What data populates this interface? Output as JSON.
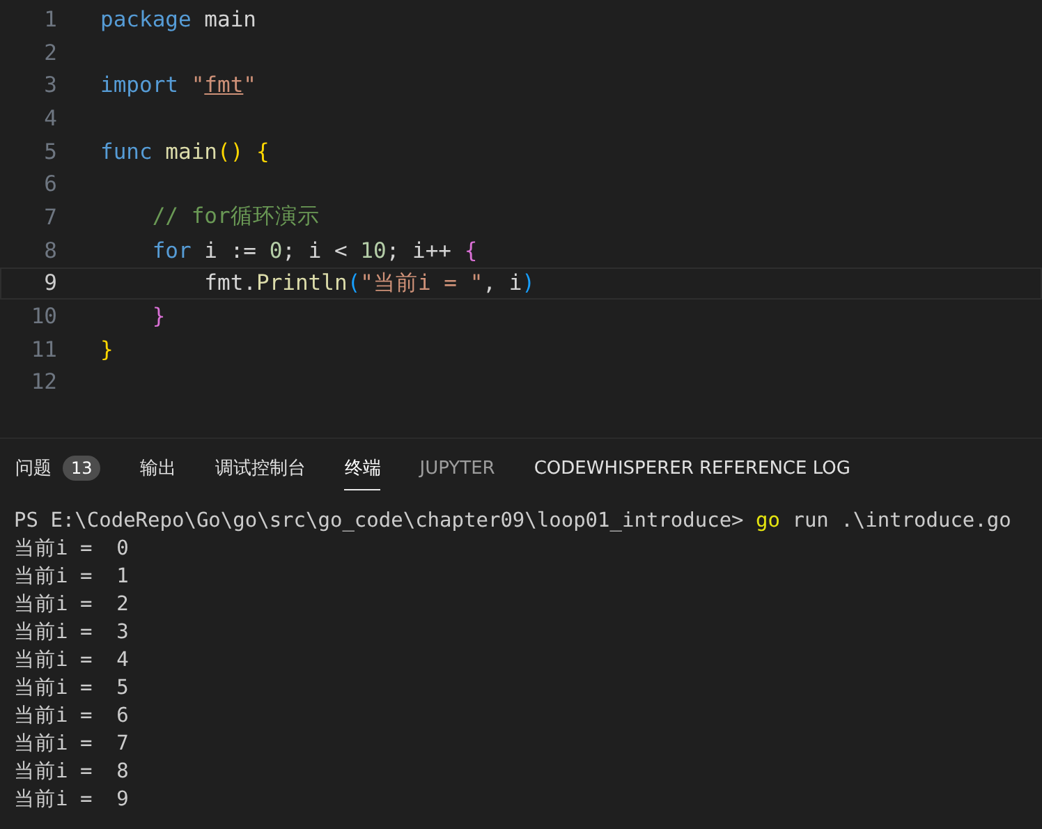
{
  "editor": {
    "lines": [
      {
        "number": "1",
        "current": false,
        "tokens": [
          {
            "kind": "keyword",
            "text": "package"
          },
          {
            "kind": "plain",
            "text": " main"
          }
        ]
      },
      {
        "number": "2",
        "current": false
      },
      {
        "number": "3",
        "current": false,
        "tokens": [
          {
            "kind": "keyword",
            "text": "import"
          },
          {
            "kind": "string",
            "text": " \""
          },
          {
            "kind": "link",
            "text": "fmt"
          },
          {
            "kind": "string",
            "text": "\""
          }
        ]
      },
      {
        "number": "4",
        "current": false
      },
      {
        "number": "5",
        "current": false,
        "tokens": [
          {
            "kind": "keyword",
            "text": "func"
          },
          {
            "kind": "function",
            "text": " main"
          },
          {
            "kind": "bracket1",
            "text": "()"
          },
          {
            "kind": "bracket1",
            "text": " {"
          }
        ]
      },
      {
        "number": "6",
        "current": false
      },
      {
        "number": "7",
        "current": false,
        "tokens": [
          {
            "kind": "comment",
            "text": "    // for循环演示"
          }
        ]
      },
      {
        "number": "8",
        "current": false,
        "tokens": [
          {
            "kind": "keyword",
            "text": "    for"
          },
          {
            "kind": "plain",
            "text": " i := "
          },
          {
            "kind": "number",
            "text": "0"
          },
          {
            "kind": "plain",
            "text": "; i < "
          },
          {
            "kind": "number",
            "text": "10"
          },
          {
            "kind": "plain",
            "text": "; i++ "
          },
          {
            "kind": "bracket2",
            "text": "{"
          }
        ]
      },
      {
        "number": "9",
        "current": true,
        "tokens": [
          {
            "kind": "plain",
            "text": "        fmt."
          },
          {
            "kind": "function",
            "text": "Println"
          },
          {
            "kind": "bracket3",
            "text": "("
          },
          {
            "kind": "string",
            "text": "\"当前i = \""
          },
          {
            "kind": "plain",
            "text": ", i"
          },
          {
            "kind": "bracket3",
            "text": ")"
          }
        ]
      },
      {
        "number": "10",
        "current": false,
        "tokens": [
          {
            "kind": "bracket2",
            "text": "    }"
          }
        ]
      },
      {
        "number": "11",
        "current": false,
        "tokens": [
          {
            "kind": "bracket1",
            "text": "}"
          }
        ]
      },
      {
        "number": "12",
        "current": false
      }
    ]
  },
  "panel": {
    "tabs": [
      {
        "label": "问题",
        "badge": "13",
        "selected": false,
        "dimmed": false
      },
      {
        "label": "输出",
        "selected": false,
        "dimmed": false
      },
      {
        "label": "调试控制台",
        "selected": false,
        "dimmed": false
      },
      {
        "label": "终端",
        "selected": true,
        "dimmed": false
      },
      {
        "label": "JUPYTER",
        "selected": false,
        "dimmed": true
      },
      {
        "label": "CODEWHISPERER REFERENCE LOG",
        "selected": false,
        "dimmed": false
      }
    ],
    "terminal": {
      "prompt": "PS E:\\CodeRepo\\Go\\go\\src\\go_code\\chapter09\\loop01_introduce> ",
      "command_name": "go",
      "command_args": " run .\\introduce.go",
      "output": [
        "当前i =  0",
        "当前i =  1",
        "当前i =  2",
        "当前i =  3",
        "当前i =  4",
        "当前i =  5",
        "当前i =  6",
        "当前i =  7",
        "当前i =  8",
        "当前i =  9"
      ]
    }
  }
}
